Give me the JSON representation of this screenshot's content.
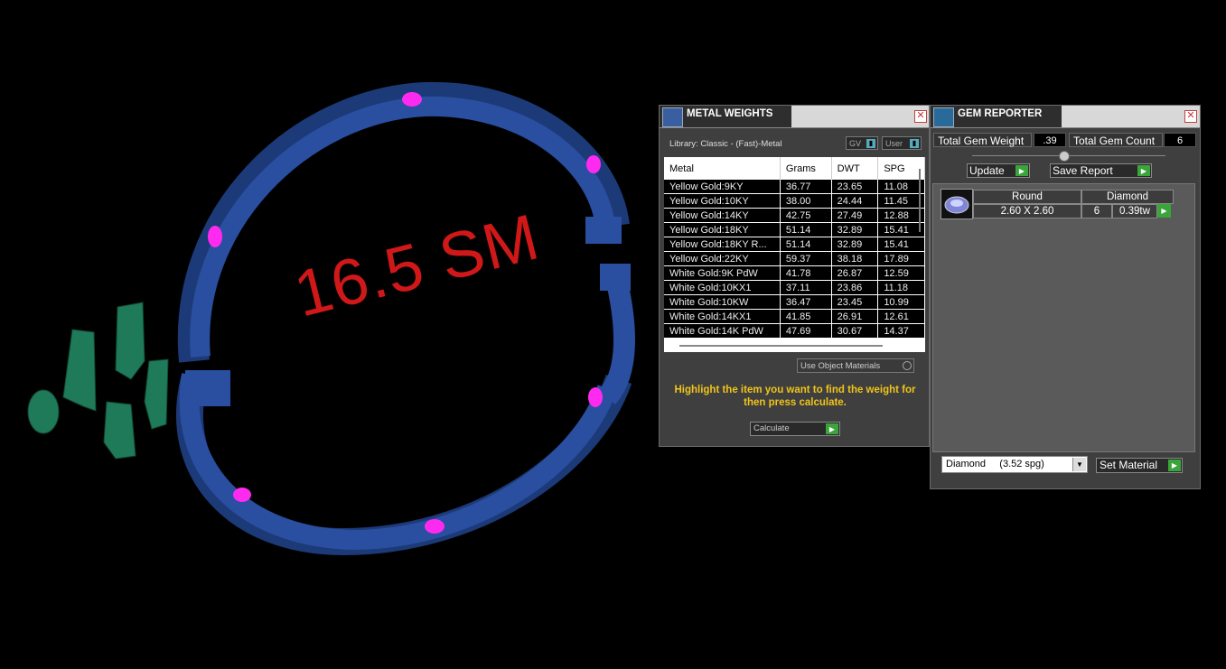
{
  "viewport": {
    "overlay_text": "16.5 SM"
  },
  "metal_weights": {
    "title": "METAL WEIGHTS",
    "library": "Library: Classic - (Fast)-Metal",
    "gv_label": "GV",
    "user_label": "User",
    "columns": [
      "Metal",
      "Grams",
      "DWT",
      "SPG"
    ],
    "rows": [
      [
        "Yellow Gold:9KY",
        "36.77",
        "23.65",
        "11.08"
      ],
      [
        "Yellow Gold:10KY",
        "38.00",
        "24.44",
        "11.45"
      ],
      [
        "Yellow Gold:14KY",
        "42.75",
        "27.49",
        "12.88"
      ],
      [
        "Yellow Gold:18KY",
        "51.14",
        "32.89",
        "15.41"
      ],
      [
        "Yellow Gold:18KY R...",
        "51.14",
        "32.89",
        "15.41"
      ],
      [
        "Yellow Gold:22KY",
        "59.37",
        "38.18",
        "17.89"
      ],
      [
        "White Gold:9K PdW",
        "41.78",
        "26.87",
        "12.59"
      ],
      [
        "White Gold:10KX1",
        "37.11",
        "23.86",
        "11.18"
      ],
      [
        "White Gold:10KW",
        "36.47",
        "23.45",
        "10.99"
      ],
      [
        "White Gold:14KX1",
        "41.85",
        "26.91",
        "12.61"
      ],
      [
        "White Gold:14K PdW",
        "47.69",
        "30.67",
        "14.37"
      ]
    ],
    "use_object_materials": "Use Object Materials",
    "hint": "Highlight the item you want to find the weight for then press calculate.",
    "calculate_label": "Calculate"
  },
  "gem_reporter": {
    "title": "GEM REPORTER",
    "total_weight_label": "Total Gem Weight",
    "total_weight_value": ".39",
    "total_count_label": "Total Gem Count",
    "total_count_value": "6",
    "update_label": "Update",
    "save_report_label": "Save Report",
    "gem": {
      "shape": "Round",
      "material": "Diamond",
      "size": "2.60 X 2.60",
      "count": "6",
      "weight": "0.39tw"
    },
    "material_select": "Diamond     (3.52 spg)",
    "set_material_label": "Set Material"
  }
}
